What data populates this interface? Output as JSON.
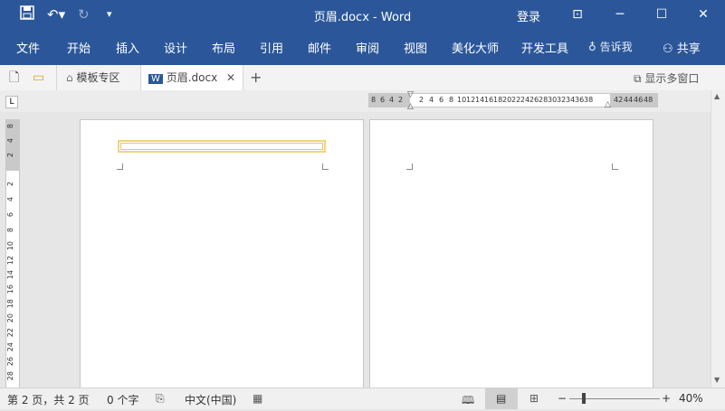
{
  "titlebar": {
    "title": "页眉.docx  -  Word",
    "login": "登录",
    "save_icon": "save-icon",
    "undo_icon": "undo-icon",
    "redo_icon": "redo-icon"
  },
  "menu": {
    "items": [
      "文件",
      "开始",
      "插入",
      "设计",
      "布局",
      "引用",
      "邮件",
      "审阅",
      "视图",
      "美化大师",
      "开发工具"
    ],
    "tell_me": "告诉我",
    "share": "共享"
  },
  "tabs": {
    "template": "模板专区",
    "document": "页眉.docx",
    "multi_window": "显示多窗口"
  },
  "ruler": {
    "h_left": [
      "8",
      "6",
      "4",
      "2"
    ],
    "h_right": [
      "2",
      "4",
      "6",
      "8",
      "10",
      "12",
      "14",
      "16",
      "18",
      "20",
      "22",
      "24",
      "26",
      "28",
      "30",
      "32",
      "34",
      "36",
      "38"
    ],
    "h_far": [
      "42",
      "44",
      "46",
      "48"
    ],
    "v_top": [
      "8",
      "4",
      "2"
    ],
    "v_main": [
      "2",
      "4",
      "6",
      "8",
      "10",
      "12",
      "14",
      "16",
      "18",
      "20",
      "22",
      "24",
      "26",
      "28"
    ]
  },
  "status": {
    "page": "第 2 页，共 2 页",
    "words": "0 个字",
    "language": "中文(中国)",
    "zoom_minus": "−",
    "zoom_plus": "+",
    "zoom": "40%"
  },
  "colors": {
    "accent": "#2b579a",
    "header_box": "#f0d67a"
  }
}
